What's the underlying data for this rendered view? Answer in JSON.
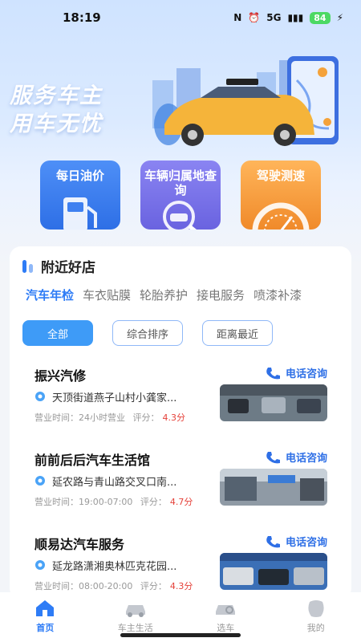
{
  "status_bar": {
    "time": "18:19",
    "network": "5G",
    "battery": "84"
  },
  "banner": {
    "slogan_line1": "服务车主",
    "slogan_line2": "用车无忧"
  },
  "tiles": [
    {
      "label": "每日油价",
      "icon": "fuel-pump-icon"
    },
    {
      "label": "车辆归属地查询",
      "icon": "car-search-icon"
    },
    {
      "label": "驾驶测速",
      "icon": "speedometer-icon"
    }
  ],
  "nearby": {
    "title": "附近好店",
    "categories": [
      "汽车年检",
      "车衣贴膜",
      "轮胎养护",
      "接电服务",
      "喷漆补漆"
    ],
    "active_category": "汽车年检",
    "filters": [
      "全部",
      "综合排序",
      "距离最近"
    ],
    "active_filter": "全部",
    "shops": [
      {
        "name": "振兴汽修",
        "phone_label": "电话咨询",
        "address": "天顶街道燕子山村小龚家...",
        "hours_label": "营业时间：",
        "hours": "24小时营业",
        "rating_label": "评分：",
        "rating": "4.3分"
      },
      {
        "name": "前前后后汽车生活馆",
        "phone_label": "电话咨询",
        "address": "延农路与青山路交叉口南...",
        "hours_label": "营业时间：",
        "hours": "19:00-07:00",
        "rating_label": "评分：",
        "rating": "4.7分"
      },
      {
        "name": "顺易达汽车服务",
        "phone_label": "电话咨询",
        "address": "延龙路潇湘奥林匹克花园...",
        "hours_label": "营业时间：",
        "hours": "08:00-20:00",
        "rating_label": "评分：",
        "rating": "4.3分"
      }
    ]
  },
  "tabbar": [
    {
      "label": "首页",
      "icon": "home-icon",
      "active": true
    },
    {
      "label": "车主生活",
      "icon": "car-icon",
      "active": false
    },
    {
      "label": "选车",
      "icon": "car-select-icon",
      "active": false
    },
    {
      "label": "我的",
      "icon": "profile-icon",
      "active": false
    }
  ],
  "colors": {
    "accent": "#2e7cf6",
    "rating": "#e5413a",
    "tile_blue": "#3f80f0",
    "tile_purple": "#7a74ea",
    "tile_orange": "#f59b3d"
  }
}
